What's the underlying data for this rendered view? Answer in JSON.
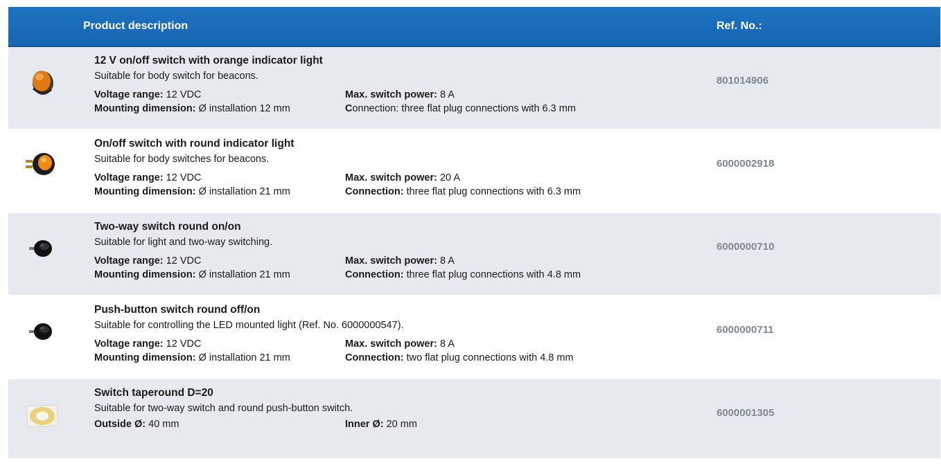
{
  "header": {
    "product_description": "Product description",
    "ref_no": "Ref. No.:"
  },
  "colors": {
    "header_blue": "#1a6bb8",
    "row_shade": "#e6eaef",
    "ref_gray": "#7d8893"
  },
  "products": [
    {
      "icon": "orange-rocker-switch-icon",
      "title": "12 V on/off switch with orange indicator light",
      "description": "Suitable for body switch for beacons.",
      "specs": [
        {
          "label": "Voltage range:",
          "value": " 12 VDC"
        },
        {
          "label": "Max. switch power:",
          "value": " 8 A"
        },
        {
          "label": "Mounting dimension:",
          "value": " Ø installation 12 mm"
        },
        {
          "label": "C",
          "label_rest": "onnection:",
          "value": " three flat plug connections with 6.3 mm"
        }
      ],
      "ref": "801014906"
    },
    {
      "icon": "round-switch-orange-light-icon",
      "title": "On/off switch with round indicator light",
      "description": "Suitable for body switches for beacons.",
      "specs": [
        {
          "label": "Voltage range:",
          "value": " 12 VDC"
        },
        {
          "label": "Max. switch power:",
          "value": " 20 A"
        },
        {
          "label": "Mounting dimension:",
          "value": " Ø installation 21 mm"
        },
        {
          "label": "Connection:",
          "value": " three flat plug connections with 6.3 mm"
        }
      ],
      "ref": "6000002918"
    },
    {
      "icon": "black-round-switch-icon",
      "title": "Two-way switch round on/on",
      "description": "Suitable for light and two-way switching.",
      "specs": [
        {
          "label": "Voltage range:",
          "value": " 12 VDC"
        },
        {
          "label": "Max. switch power:",
          "value": " 8 A"
        },
        {
          "label": "Mounting dimension:",
          "value": " Ø installation 21 mm"
        },
        {
          "label": "Connection:",
          "value": " three flat plug connections with 4.8 mm"
        }
      ],
      "ref": "6000000710"
    },
    {
      "icon": "black-push-button-icon",
      "title": "Push-button switch round off/on",
      "description": "Suitable for controlling the LED mounted light (Ref. No. 6000000547).",
      "specs": [
        {
          "label": "Voltage range:",
          "value": " 12 VDC"
        },
        {
          "label": "Max. switch power:",
          "value": " 8 A"
        },
        {
          "label": "Mounting dimension:",
          "value": " Ø installation 21 mm"
        },
        {
          "label": "Connection:",
          "value": " two flat plug connections with 4.8 mm"
        }
      ],
      "ref": "6000000711"
    },
    {
      "icon": "tape-ring-icon",
      "title": "Switch taperound D=20",
      "description": "Suitable for two-way switch and round push-button switch.",
      "specs": [
        {
          "label": "Outside Ø:",
          "value": " 40 mm"
        },
        {
          "label": "Inner Ø:",
          "value": " 20 mm"
        }
      ],
      "ref": "6000001305"
    }
  ]
}
